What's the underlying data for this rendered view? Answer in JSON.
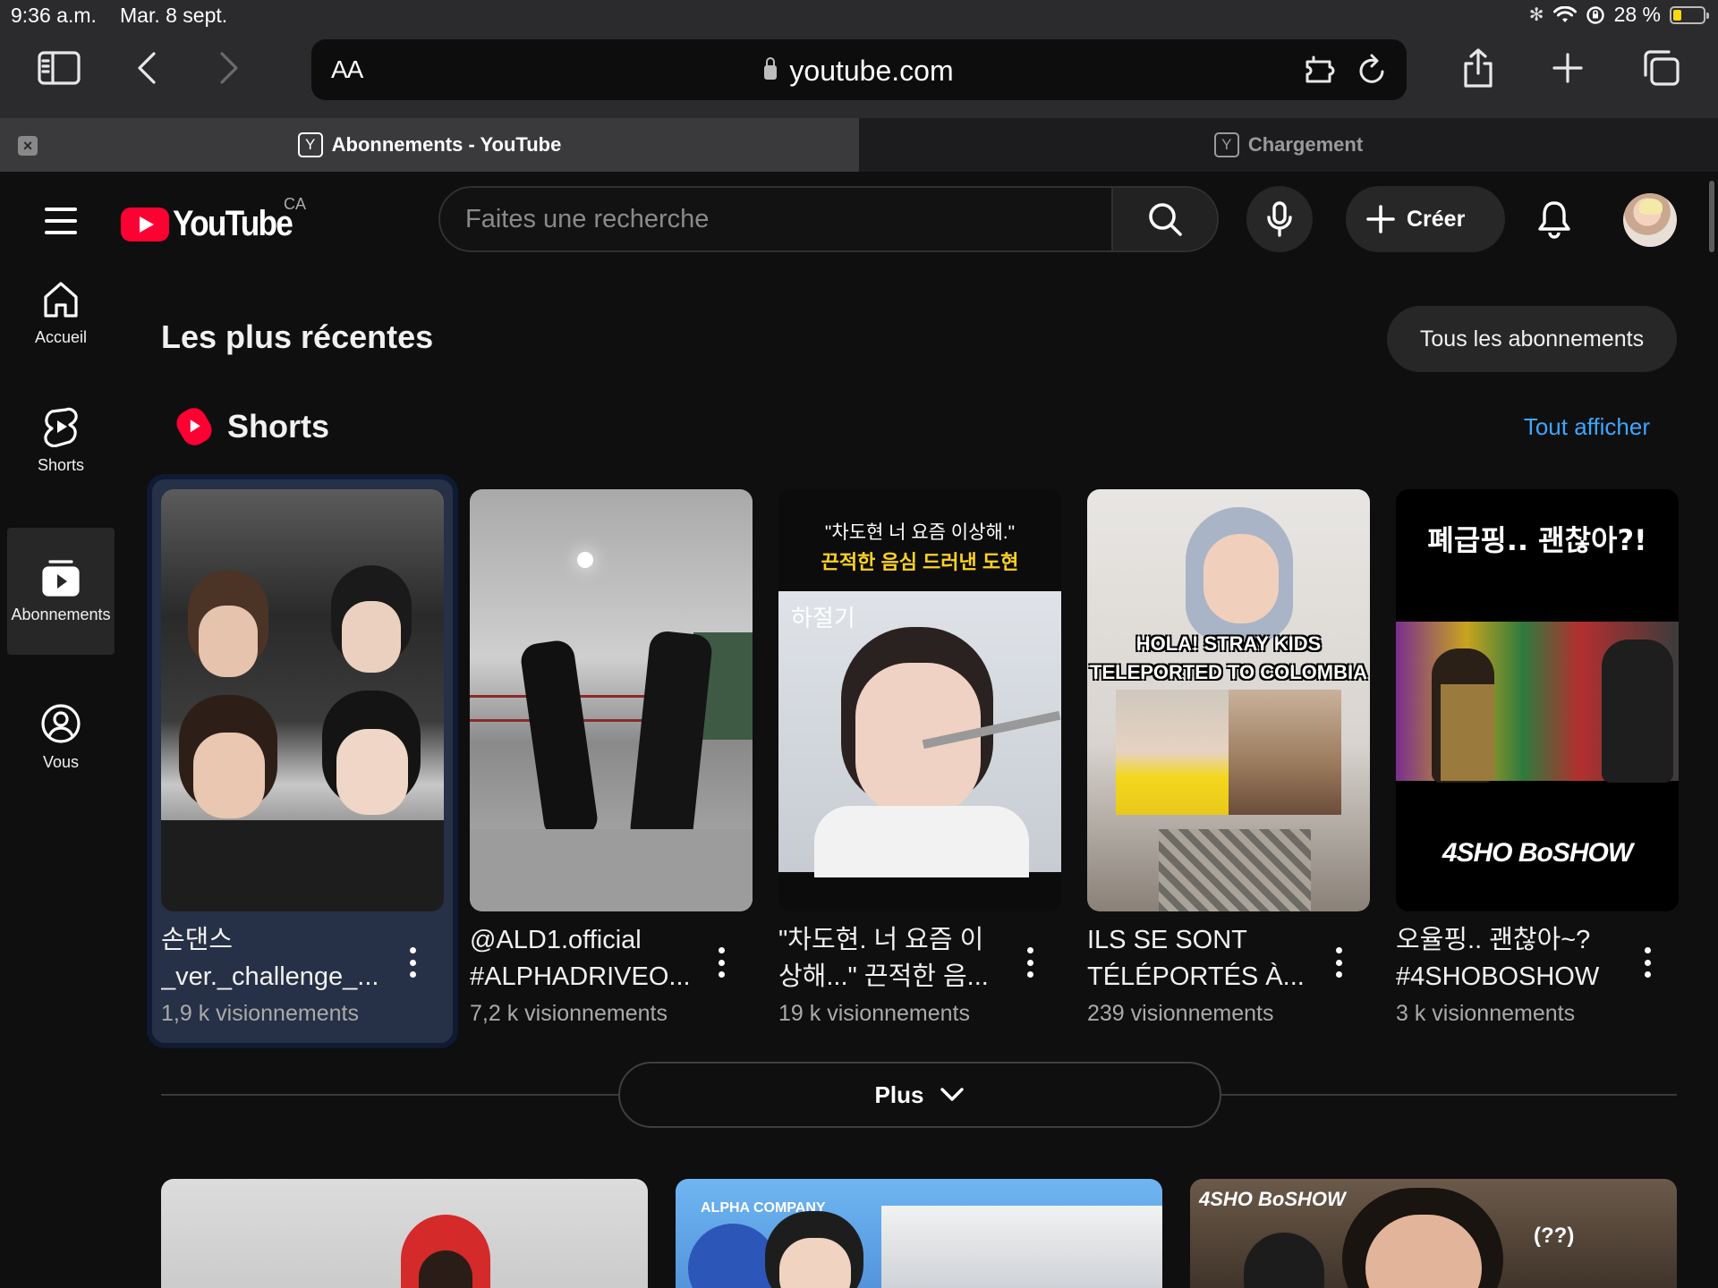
{
  "status_bar": {
    "time": "9:36 a.m.",
    "date": "Mar. 8 sept.",
    "battery": "28 %",
    "battery_level": 0.28
  },
  "browser": {
    "text_size_label": "AA",
    "url": "youtube.com",
    "tabs": [
      {
        "title": "Abonnements - YouTube",
        "favicon": "Y",
        "active": true
      },
      {
        "title": "Chargement",
        "favicon": "Y",
        "active": false
      }
    ]
  },
  "masthead": {
    "logo_text": "YouTube",
    "country": "CA",
    "search_placeholder": "Faites une recherche",
    "create_label": "Créer"
  },
  "guide": [
    {
      "label": "Accueil",
      "icon": "home-icon"
    },
    {
      "label": "Shorts",
      "icon": "shorts-icon"
    },
    {
      "label": "Abonnements",
      "icon": "subscriptions-icon",
      "active": true
    },
    {
      "label": "Vous",
      "icon": "account-icon"
    }
  ],
  "content": {
    "page_title": "Les plus récentes",
    "all_subs_button": "Tous les abonnements",
    "shorts_title": "Shorts",
    "see_all": "Tout afficher",
    "shorts": [
      {
        "title": "손댄스 _ver._challenge_...",
        "views": "1,9 k visionnements",
        "thumb_top": "",
        "thumb_sub": ""
      },
      {
        "title": "@ALD1.official #ALPHADRIVEO...",
        "views": "7,2 k visionnements",
        "thumb_top": "",
        "thumb_sub": ""
      },
      {
        "title": "\"차도현. 너 요즘 이상해...\" 끈적한 음...",
        "views": "19 k visionnements",
        "thumb_top": "\"차도현 너 요즘 이상해.\"",
        "thumb_sub": "끈적한 음심 드러낸 도현",
        "thumb_overlay": "하절기"
      },
      {
        "title": "ILS SE SONT TÉLÉPORTÉS À...",
        "views": "239 visionnements",
        "thumb_top": "HOLA! STRAY KIDS",
        "thumb_sub": "TELEPORTED TO COLOMBIA"
      },
      {
        "title": "오율핑.. 괜찮아~? #4SHOBOSHOW ...",
        "views": "3 k visionnements",
        "thumb_top": "폐급핑.. 괜찮아?!",
        "thumb_sub": "4SHO BoSHOW"
      }
    ],
    "more_label": "Plus",
    "videos": [
      {
        "overlay": ""
      },
      {
        "overlay": "ALPHA COMPANY"
      },
      {
        "overlay": "4SHO BoSHOW",
        "badge": "(??)"
      }
    ]
  }
}
